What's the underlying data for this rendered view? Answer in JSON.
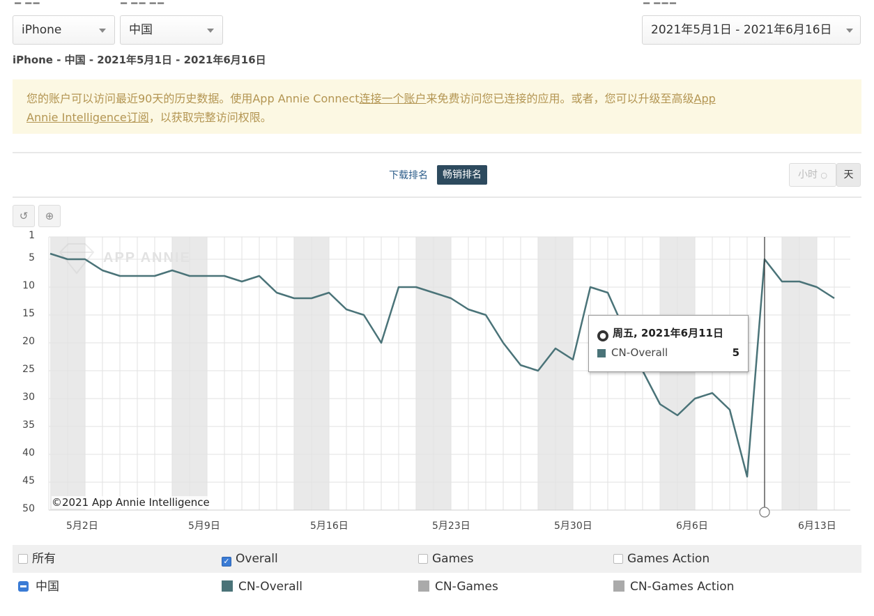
{
  "filters": {
    "device": "iPhone",
    "country": "中国",
    "date_range": "2021年5月1日 - 2021年6月16日",
    "summary": "iPhone - 中国 - 2021年5月1日 - 2021年6月16日"
  },
  "notice": {
    "p1": "您的账户可以访问最近90天的历史数据。使用App Annie Connect",
    "link1": "连接一个账户",
    "p2": "来免费访问您已连接的应用。或者，您可以升级至高级",
    "link2a": "App",
    "link2b": "Annie Intelligence订阅",
    "p3": "，以获取完整访问权限。"
  },
  "tabs": {
    "downloads": "下载排名",
    "grossing": "畅销排名"
  },
  "granularity": {
    "hourly": "小时",
    "daily": "天"
  },
  "watermark": "APP ANNIE",
  "copyright": "©2021 App Annie Intelligence",
  "tooltip": {
    "date": "周五, 2021年6月11日",
    "series": "CN-Overall",
    "value": "5"
  },
  "legend": {
    "all": "所有",
    "overall": "Overall",
    "games": "Games",
    "games_action": "Games Action",
    "country": "中国",
    "cn_overall": "CN-Overall",
    "cn_games": "CN-Games",
    "cn_games_action": "CN-Games Action"
  },
  "colors": {
    "line": "#4a7378",
    "grey_swatch": "#aaaaaa",
    "active_tab": "#2d4a5e",
    "checkbox": "#3a7bd5"
  },
  "chart_data": {
    "type": "line",
    "y_reversed": true,
    "ylim": [
      1,
      50
    ],
    "y_ticks": [
      "1",
      "5",
      "10",
      "15",
      "20",
      "25",
      "30",
      "35",
      "40",
      "45",
      "50"
    ],
    "x_tick_labels": [
      "5月2日",
      "5月9日",
      "5月16日",
      "5月23日",
      "5月30日",
      "6月6日",
      "6月13日"
    ],
    "grid": true,
    "series": [
      {
        "name": "CN-Overall",
        "x": [
          "2021-05-01",
          "2021-05-02",
          "2021-05-03",
          "2021-05-04",
          "2021-05-05",
          "2021-05-06",
          "2021-05-07",
          "2021-05-08",
          "2021-05-09",
          "2021-05-10",
          "2021-05-11",
          "2021-05-12",
          "2021-05-13",
          "2021-05-14",
          "2021-05-15",
          "2021-05-16",
          "2021-05-17",
          "2021-05-18",
          "2021-05-19",
          "2021-05-20",
          "2021-05-21",
          "2021-05-22",
          "2021-05-23",
          "2021-05-24",
          "2021-05-25",
          "2021-05-26",
          "2021-05-27",
          "2021-05-28",
          "2021-05-29",
          "2021-05-30",
          "2021-05-31",
          "2021-06-01",
          "2021-06-02",
          "2021-06-03",
          "2021-06-04",
          "2021-06-05",
          "2021-06-06",
          "2021-06-07",
          "2021-06-08",
          "2021-06-09",
          "2021-06-10",
          "2021-06-11",
          "2021-06-12",
          "2021-06-13",
          "2021-06-14",
          "2021-06-15"
        ],
        "values": [
          4,
          5,
          5,
          7,
          8,
          8,
          8,
          7,
          8,
          8,
          8,
          9,
          8,
          11,
          12,
          12,
          11,
          14,
          15,
          20,
          10,
          10,
          11,
          12,
          14,
          15,
          20,
          24,
          25,
          21,
          23,
          10,
          11,
          18,
          25,
          31,
          33,
          30,
          29,
          32,
          44,
          5,
          9,
          9,
          10,
          12
        ]
      }
    ]
  }
}
